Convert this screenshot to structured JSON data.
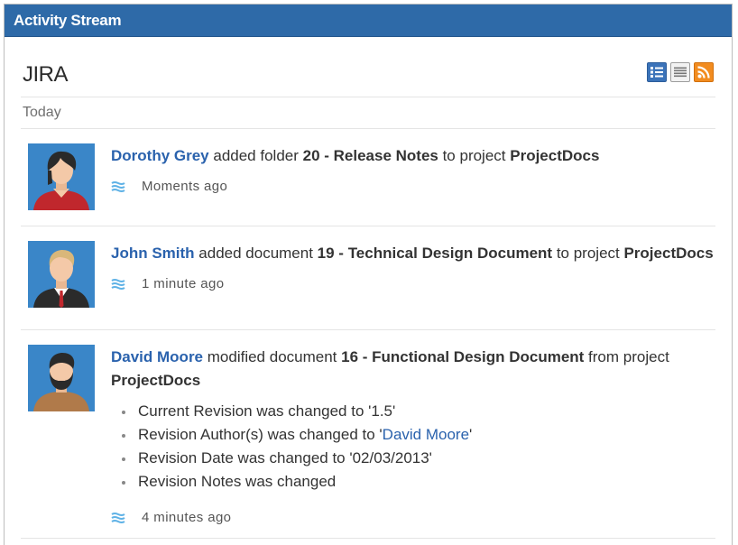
{
  "gadget": {
    "title": "Activity Stream"
  },
  "header": {
    "app_title": "JIRA",
    "view_icons": [
      "full-view-icon",
      "list-view-icon",
      "rss-feed-icon"
    ]
  },
  "date_group": "Today",
  "entries": [
    {
      "actor": "Dorothy Grey",
      "verb": " added folder ",
      "object": "20 - Release Notes",
      "connector": " to project ",
      "project": "ProjectDocs",
      "time": "Moments ago",
      "avatar": "female-dark-hair-avatar"
    },
    {
      "actor": "John Smith",
      "verb": " added document ",
      "object": "19 - Technical Design Document",
      "connector": " to project ",
      "project": "ProjectDocs",
      "time": "1 minute ago",
      "avatar": "male-blond-suit-avatar"
    },
    {
      "actor": "David Moore",
      "verb": " modified document ",
      "object": "16 - Functional Design Document",
      "connector": " from project ",
      "project": "ProjectDocs",
      "time": "4 minutes ago",
      "avatar": "male-bearded-avatar",
      "changes": [
        {
          "text": "Current Revision was changed to '1.5'"
        },
        {
          "pre": "Revision Author(s) was changed to '",
          "link": "David Moore",
          "post": "'"
        },
        {
          "text": "Revision Date was changed to '02/03/2013'"
        },
        {
          "text": "Revision Notes was changed"
        }
      ]
    }
  ],
  "colors": {
    "titlebar": "#2e6aa8",
    "link": "#2a62ad",
    "stream_icon": "#5fb2e6",
    "rss": "#f28c20"
  }
}
